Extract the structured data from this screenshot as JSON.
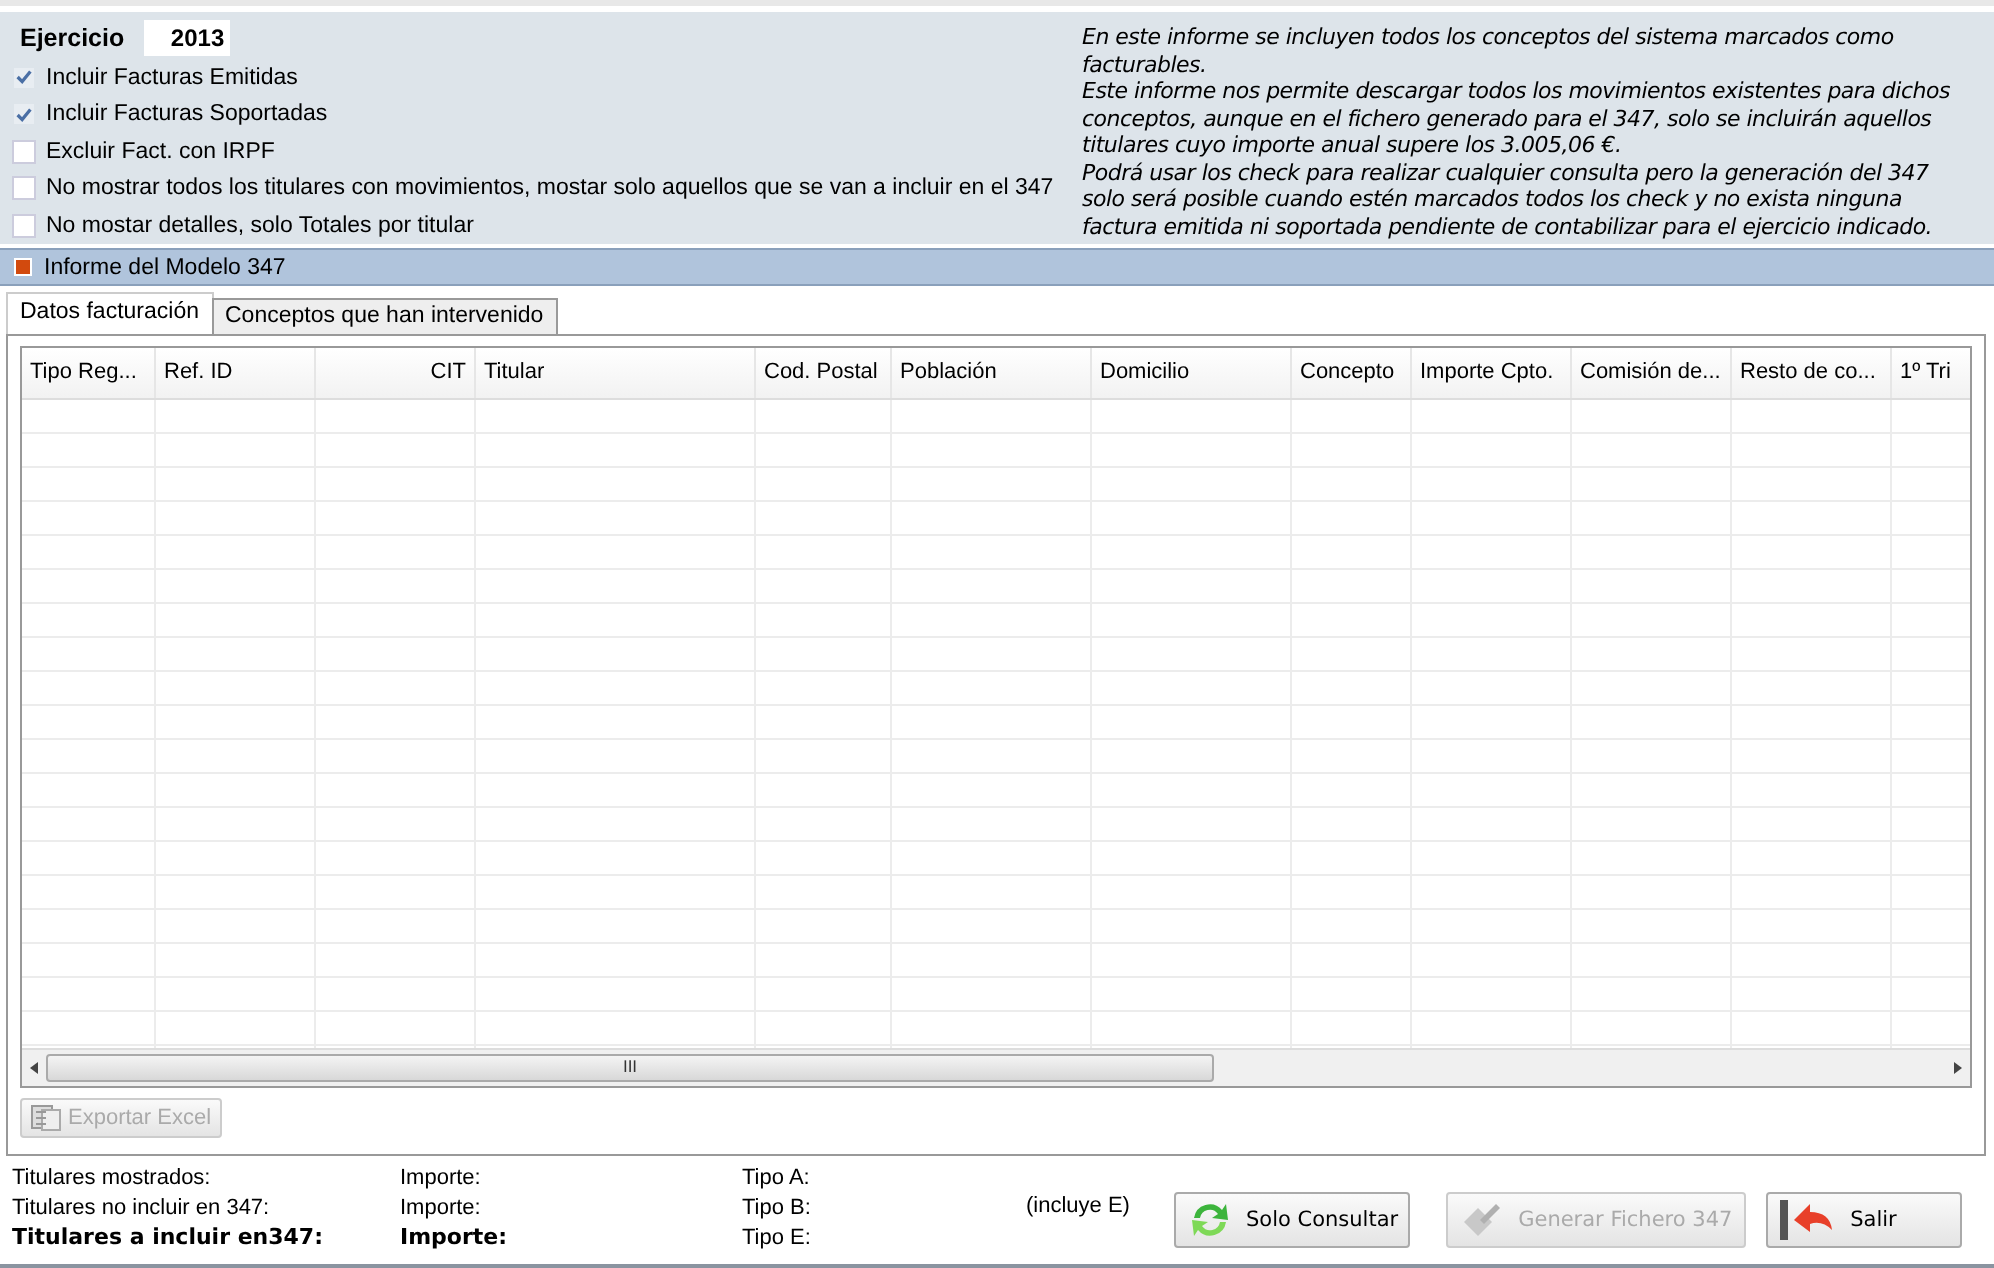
{
  "filter": {
    "year_label": "Ejercicio",
    "year_value": "2013",
    "options": [
      {
        "label": "Incluir Facturas Emitidas",
        "checked": true
      },
      {
        "label": "Incluir Facturas Soportadas",
        "checked": true
      },
      {
        "label": "Excluir Fact. con IRPF",
        "checked": false
      },
      {
        "label": "No mostrar todos los titulares con movimientos, mostar solo aquellos que se van a incluir en el 347",
        "checked": false
      },
      {
        "label": "No mostar detalles, solo Totales por titular",
        "checked": false
      }
    ],
    "info": "En este informe se incluyen todos los conceptos del sistema marcados como\nfacturables.\nEste informe nos permite descargar todos los movimientos existentes para dichos\nconceptos, aunque en el fichero generado para el 347, solo se incluirán aquellos\ntitulares cuyo importe anual supere los 3.005,06 €.\nPodrá usar los check para realizar cualquier consulta pero la generación del 347\nsolo será posible cuando estén marcados todos los check y no exista ninguna\nfactura emitida ni soportada pendiente de contabilizar para el ejercicio indicado."
  },
  "section": {
    "title": "Informe del Modelo 347"
  },
  "tabs": [
    {
      "label": "Datos facturación",
      "selected": true
    },
    {
      "label": "Conceptos que han intervenido",
      "selected": false
    }
  ],
  "table": {
    "columns": [
      {
        "label": "Tipo Reg...",
        "kind": "text"
      },
      {
        "label": "Ref. ID",
        "kind": "text"
      },
      {
        "label": "CIT",
        "kind": "number"
      },
      {
        "label": "Titular",
        "kind": "text"
      },
      {
        "label": "Cod. Postal",
        "kind": "text"
      },
      {
        "label": "Población",
        "kind": "text"
      },
      {
        "label": "Domicilio",
        "kind": "text"
      },
      {
        "label": "Concepto",
        "kind": "text"
      },
      {
        "label": "Importe Cpto.",
        "kind": "text"
      },
      {
        "label": "Comisión de...",
        "kind": "text"
      },
      {
        "label": "Resto de co...",
        "kind": "text"
      },
      {
        "label": "1º Tri",
        "kind": "text"
      }
    ],
    "scroll_grip": "III"
  },
  "export_button": {
    "label": "Exportar Excel",
    "disabled": true
  },
  "summary": [
    {
      "label": "Titulares mostrados:",
      "amount": "Importe:",
      "type": "Tipo A:",
      "bold": false
    },
    {
      "label": "Titulares no incluir en 347:",
      "amount": "Importe:",
      "type": "Tipo B:",
      "bold": false
    },
    {
      "label": "Titulares a incluir en347:",
      "amount": "Importe:",
      "type": "Tipo E:",
      "bold": true
    }
  ],
  "summary_note": "(incluye E)",
  "buttons": [
    {
      "label": "Solo Consultar",
      "kind": "refresh",
      "disabled": false
    },
    {
      "label": "Generar Fichero 347",
      "kind": "generate",
      "disabled": true
    },
    {
      "label": "Salir",
      "kind": "exit",
      "disabled": false
    }
  ]
}
